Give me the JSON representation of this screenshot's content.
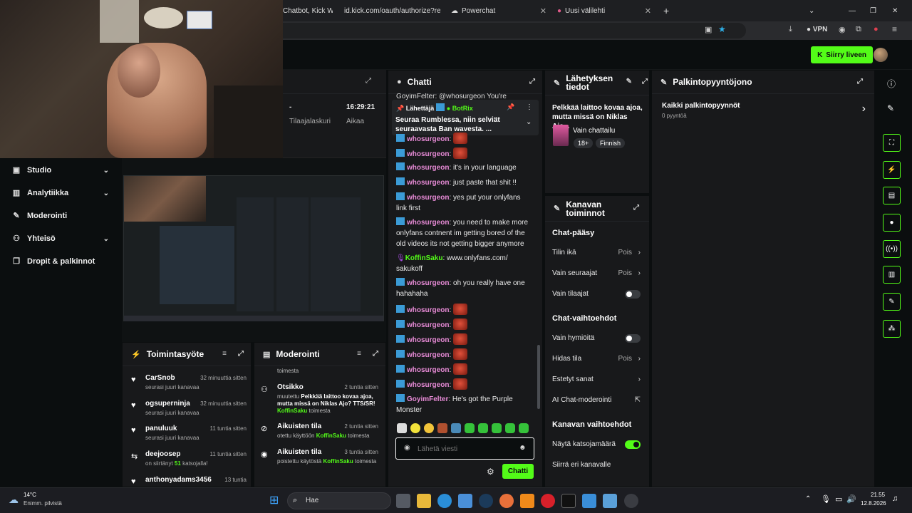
{
  "tabs": [
    {
      "label": "Chatbot, Kick Wid"
    },
    {
      "label": "id.kick.com/oauth/authorize?respo"
    },
    {
      "label": "Powerchat"
    },
    {
      "label": "Uusi välilehti"
    }
  ],
  "browser": {
    "vpn_label": "VPN"
  },
  "topbar": {
    "go_live_label": "Siirry liveen"
  },
  "stats": {
    "time": "16:29:21",
    "dash": "-",
    "label1": "Tilaajalaskuri",
    "label2": "Aikaa"
  },
  "sidebar": {
    "items": [
      {
        "label": "Studio",
        "icon": "studio-icon",
        "has_chevron": true
      },
      {
        "label": "Analytiikka",
        "icon": "chart-icon",
        "has_chevron": true
      },
      {
        "label": "Moderointi",
        "icon": "wrench-icon",
        "has_chevron": false
      },
      {
        "label": "Yhteisö",
        "icon": "people-icon",
        "has_chevron": true
      },
      {
        "label": "Dropit & palkinnot",
        "icon": "gift-icon",
        "has_chevron": false
      }
    ]
  },
  "chat": {
    "title": "Chatti",
    "partial_top": "GoyimFelter: @whosurgeon You're",
    "pinned": {
      "by_label": "Lähettäjä",
      "by_user": "BotRix",
      "text": "Seuraa Rumblessa, niin selviät seuraavasta Ban wavesta.",
      "suffix": "..."
    },
    "messages": [
      {
        "user": "whosurgeon",
        "text": "",
        "emote": true
      },
      {
        "user": "whosurgeon",
        "text": "",
        "emote": true
      },
      {
        "user": "whosurgeon",
        "text": "it's in your language"
      },
      {
        "user": "whosurgeon",
        "text": "just paste that shit !!"
      },
      {
        "user": "whosurgeon",
        "text": "yes put your onlyfans link first"
      },
      {
        "user": "whosurgeon",
        "text": "you need to make more onlyfans contnent im getting bored of the old videos its not getting bigger anymore"
      },
      {
        "user": "KoffinSaku",
        "text": "www.onlyfans.com/ sakukoff"
      },
      {
        "user": "whosurgeon",
        "text": "oh you really have one hahahaha"
      },
      {
        "user": "whosurgeon",
        "text": "",
        "emote": true
      },
      {
        "user": "whosurgeon",
        "text": "",
        "emote": true
      },
      {
        "user": "whosurgeon",
        "text": "",
        "emote": true
      },
      {
        "user": "whosurgeon",
        "text": "",
        "emote": true
      },
      {
        "user": "whosurgeon",
        "text": "",
        "emote": true
      },
      {
        "user": "whosurgeon",
        "text": "",
        "emote": true
      },
      {
        "user": "GoyimFelter",
        "text": "He's got the Purple Monster"
      }
    ],
    "input_placeholder": "Lähetä viesti",
    "send_label": "Chatti"
  },
  "stream_info": {
    "title": "Lähetyksen tiedot",
    "stream_title": "Pelkkää laittoo kovaa ajoa, mutta missä on Niklas Ajo...",
    "category": "Vain chattailu",
    "tags": [
      "18+",
      "Finnish"
    ]
  },
  "channel_settings": {
    "title": "Kanavan toiminnot",
    "sections": [
      {
        "title": "Chat-pääsy"
      },
      {
        "title": "Chat-vaihtoehdot"
      },
      {
        "title": "Kanavan vaihtoehdot"
      }
    ],
    "rows": {
      "account_age": {
        "label": "Tilin ikä",
        "value": "Pois"
      },
      "followers_only": {
        "label": "Vain seuraajat",
        "value": "Pois"
      },
      "subs_only": {
        "label": "Vain tilaajat",
        "enabled": false
      },
      "emotes_only": {
        "label": "Vain hymiöitä",
        "enabled": false
      },
      "slow_mode": {
        "label": "Hidas tila",
        "value": "Pois"
      },
      "banned_words": {
        "label": "Estetyt sanat"
      },
      "ai_mod": {
        "label": "AI Chat-moderointi"
      },
      "show_viewers": {
        "label": "Näytä katsojamäärä",
        "enabled": true
      },
      "move_channel": {
        "label": "Siirrä eri kanavalle"
      }
    }
  },
  "rewards": {
    "title": "Palkintopyyntöjono",
    "all_label": "Kaikki palkintopyynnöt",
    "count": "0 pyyntöä"
  },
  "activity": {
    "title": "Toimintasyöte",
    "items": [
      {
        "name": "CarSnob",
        "time": "32 minuuttia sitten",
        "desc": "seurasi juuri kanavaa",
        "icon": "heart-icon"
      },
      {
        "name": "ogsuperninja",
        "time": "32 minuuttia sitten",
        "desc": "seurasi juuri kanavaa",
        "icon": "heart-icon"
      },
      {
        "name": "panuluuk",
        "time": "11 tuntia sitten",
        "desc": "seurasi juuri kanavaa",
        "icon": "heart-icon"
      },
      {
        "name": "deejoosep",
        "time": "11 tuntia sitten",
        "desc_pre": "on siirtänyt",
        "desc_num": "51",
        "desc_post": "katsojalla!",
        "icon": "host-icon"
      },
      {
        "name": "anthonyadams3456",
        "time": "13 tuntia",
        "desc": "",
        "icon": "heart-icon"
      }
    ]
  },
  "moderation": {
    "title": "Moderointi",
    "partial_top": "toimesta",
    "items": [
      {
        "name": "Otsikko",
        "time": "2 tuntia sitten",
        "pre": "muutettu",
        "bold": "Pelkkää laittoo kovaa ajoa, mutta missä on Niklas Ajo? TTS/SR!",
        "user": "KoffinSaku",
        "post": "toimesta",
        "icon": "people-icon"
      },
      {
        "name": "Aikuisten tila",
        "time": "2 tuntia sitten",
        "pre": "otettu käyttöön",
        "user": "KoffinSaku",
        "post": "toimesta",
        "icon": "eye-off-icon"
      },
      {
        "name": "Aikuisten tila",
        "time": "3 tuntia sitten",
        "pre": "poistettu käytöstä",
        "user": "KoffinSaku",
        "post": "toimesta",
        "icon": "eye-icon"
      }
    ]
  },
  "taskbar": {
    "weather_temp": "14°C",
    "weather_desc": "Enimm. pilvistä",
    "search_placeholder": "Hae",
    "clock_time": "21.55",
    "clock_date": "12.8.2026"
  },
  "colors": {
    "accent": "#53fc18",
    "panel": "#18191b",
    "bg": "#0b0e0f",
    "username_pink": "#e88bd7"
  }
}
